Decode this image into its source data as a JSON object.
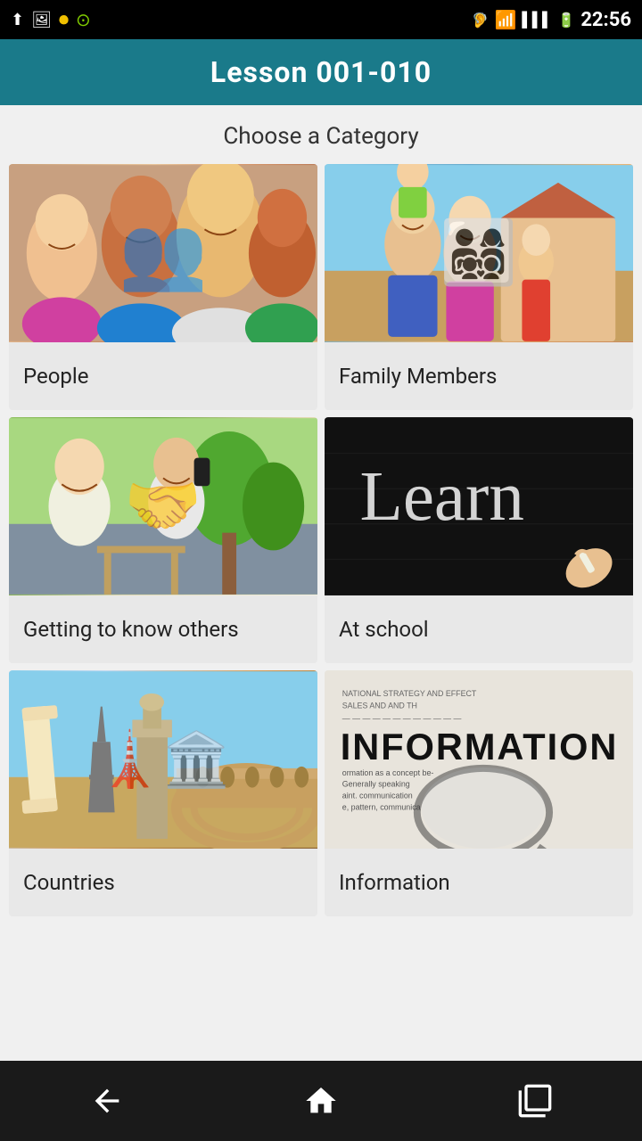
{
  "statusBar": {
    "time": "22:56",
    "icons": [
      "usb",
      "image",
      "audio",
      "speed"
    ]
  },
  "header": {
    "title": "Lesson 001-010"
  },
  "main": {
    "subtitle": "Choose a Category",
    "categories": [
      {
        "id": "people",
        "label": "People",
        "imageType": "people"
      },
      {
        "id": "family-members",
        "label": "Family Members",
        "imageType": "family"
      },
      {
        "id": "getting-to-know",
        "label": "Getting to know others",
        "imageType": "getting"
      },
      {
        "id": "at-school",
        "label": "At school",
        "imageType": "school",
        "chalkText": "Learn"
      },
      {
        "id": "countries",
        "label": "Countries",
        "imageType": "countries"
      },
      {
        "id": "information",
        "label": "Information",
        "imageType": "information"
      }
    ]
  },
  "bottomNav": {
    "back_label": "back",
    "home_label": "home",
    "recents_label": "recents"
  }
}
